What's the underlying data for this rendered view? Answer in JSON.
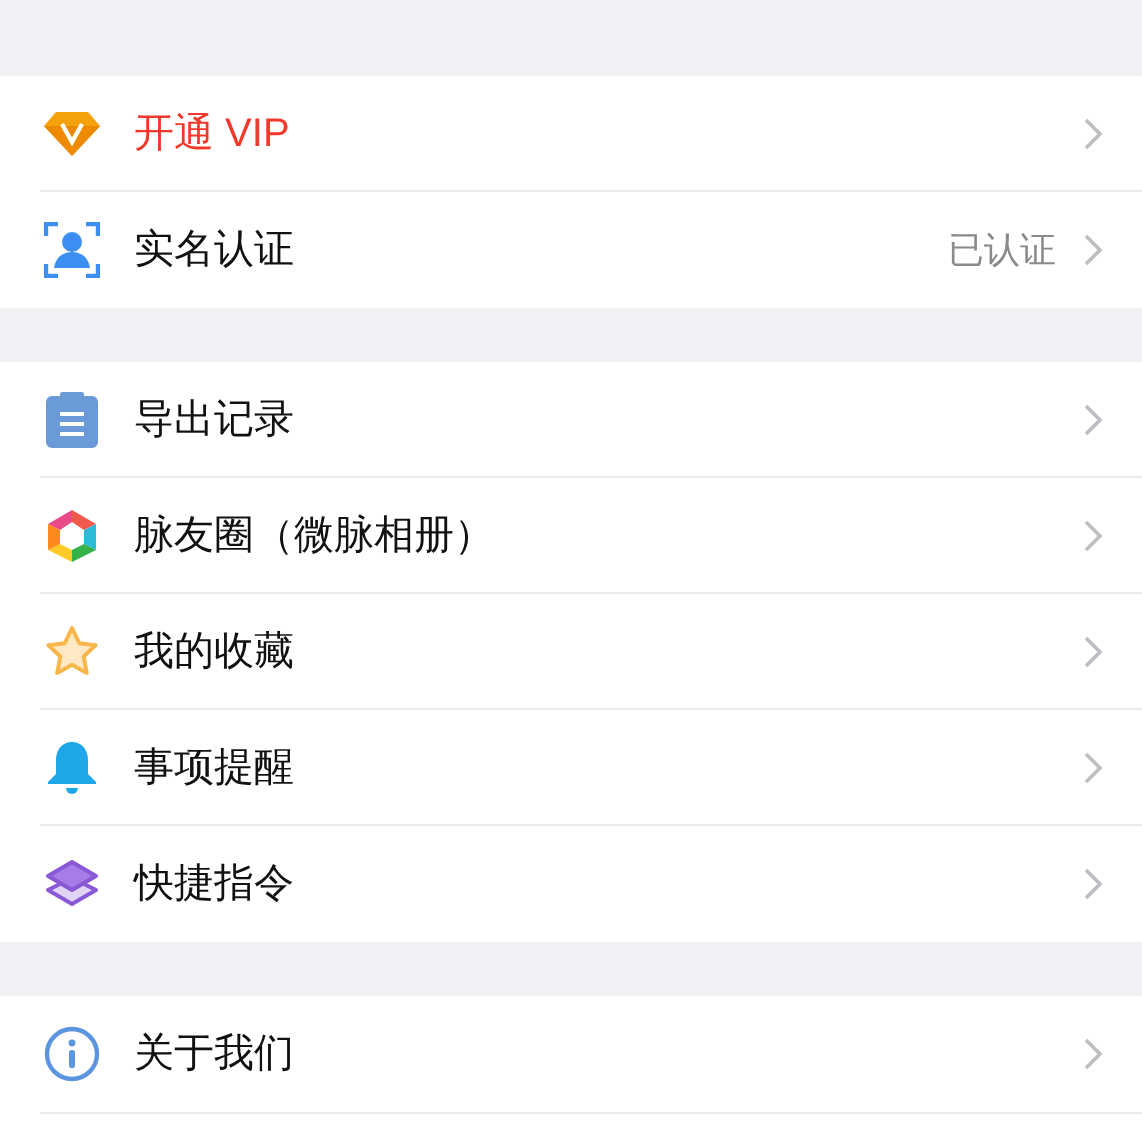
{
  "sections": [
    {
      "items": [
        {
          "label": "开通 VIP",
          "highlight": true
        },
        {
          "label": "实名认证",
          "highlight": false,
          "status": "已认证"
        }
      ]
    },
    {
      "items": [
        {
          "label": "导出记录",
          "highlight": false
        },
        {
          "label": "脉友圈（微脉相册）",
          "highlight": false
        },
        {
          "label": "我的收藏",
          "highlight": false
        },
        {
          "label": "事项提醒",
          "highlight": false
        },
        {
          "label": "快捷指令",
          "highlight": false
        }
      ]
    },
    {
      "items": [
        {
          "label": "关于我们",
          "highlight": false
        }
      ]
    }
  ]
}
